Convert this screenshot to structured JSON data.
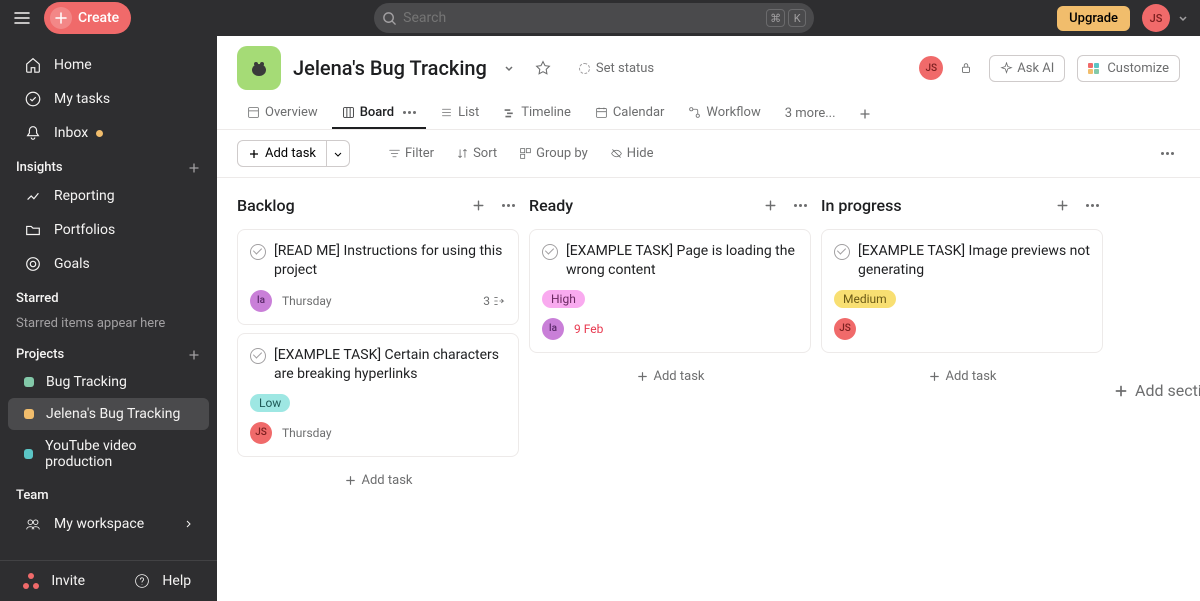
{
  "topbar": {
    "create": "Create",
    "search_ph": "Search",
    "kbd1": "⌘",
    "kbd2": "K",
    "upgrade": "Upgrade",
    "user": "JS"
  },
  "sidebar": {
    "nav": [
      {
        "label": "Home"
      },
      {
        "label": "My tasks"
      },
      {
        "label": "Inbox"
      }
    ],
    "insights": {
      "title": "Insights",
      "items": [
        "Reporting",
        "Portfolios",
        "Goals"
      ]
    },
    "starred": {
      "title": "Starred",
      "empty": "Starred items appear here"
    },
    "projects": {
      "title": "Projects",
      "items": [
        {
          "label": "Bug Tracking",
          "color": "d-green"
        },
        {
          "label": "Jelena's Bug Tracking",
          "color": "d-orange",
          "active": true
        },
        {
          "label": "YouTube video production",
          "color": "d-teal"
        }
      ]
    },
    "team": {
      "title": "Team",
      "item": "My workspace"
    },
    "invite": "Invite",
    "help": "Help"
  },
  "project": {
    "title": "Jelena's Bug Tracking",
    "set_status": "Set status",
    "ask": "Ask AI",
    "customize": "Customize",
    "tabs": [
      "Overview",
      "Board",
      "List",
      "Timeline",
      "Calendar",
      "Workflow"
    ],
    "tabs_more": "3 more..."
  },
  "toolbar": {
    "add": "Add task",
    "filter": "Filter",
    "sort": "Sort",
    "group": "Group by",
    "hide": "Hide"
  },
  "board": {
    "add_task": "Add task",
    "add_section": "Add section",
    "columns": [
      {
        "name": "Backlog",
        "cards": [
          {
            "title": "[READ ME] Instructions for using this project",
            "assignee": "la",
            "date": "Thursday",
            "sub": "3"
          },
          {
            "title": "[EXAMPLE TASK] Certain characters are breaking hyperlinks",
            "priority": "Low",
            "assignee": "JS",
            "date": "Thursday"
          }
        ]
      },
      {
        "name": "Ready",
        "cards": [
          {
            "title": "[EXAMPLE TASK] Page is loading the wrong content",
            "priority": "High",
            "assignee": "la",
            "date": "9 Feb",
            "due": true
          }
        ]
      },
      {
        "name": "In progress",
        "cards": [
          {
            "title": "[EXAMPLE TASK] Image previews not generating",
            "priority": "Medium",
            "assignee": "JS"
          }
        ]
      }
    ]
  }
}
